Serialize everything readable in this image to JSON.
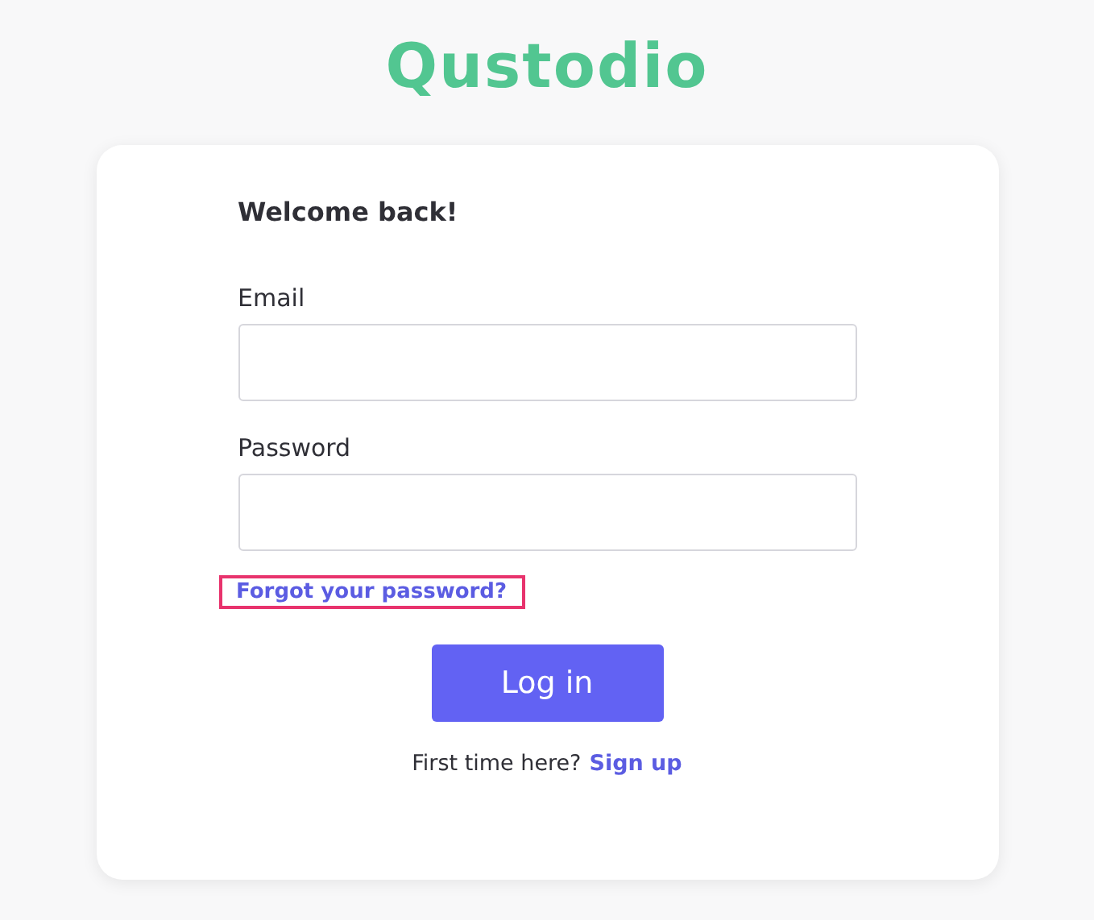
{
  "logo": "Qustodio",
  "form": {
    "heading": "Welcome back!",
    "fields": [
      {
        "label": "Email"
      },
      {
        "label": "Password"
      }
    ],
    "forgot_link": {
      "text": "Forgot your password?",
      "highlighted": true
    },
    "submit": "Log in",
    "signup": {
      "prompt": "First time here?",
      "link": "Sign up"
    }
  }
}
